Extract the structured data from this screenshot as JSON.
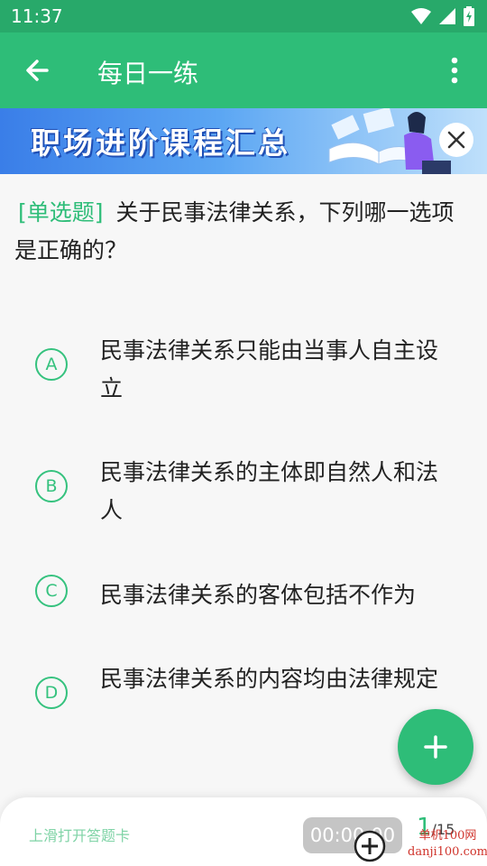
{
  "status_bar": {
    "time": "11:37"
  },
  "app_bar": {
    "title": "每日一练"
  },
  "banner": {
    "text": "职场进阶课程汇总"
  },
  "question": {
    "type_label": "[单选题]",
    "text": "关于民事法律关系，下列哪一选项是正确的？"
  },
  "options": [
    {
      "letter": "A",
      "text": "民事法律关系只能由当事人自主设立"
    },
    {
      "letter": "B",
      "text": "民事法律关系的主体即自然人和法人"
    },
    {
      "letter": "C",
      "text": "民事法律关系的客体包括不作为"
    },
    {
      "letter": "D",
      "text": "民事法律关系的内容均由法律规定"
    }
  ],
  "bottom_bar": {
    "swipe_hint": "上滑打开答题卡",
    "timer": "00:00:00",
    "current": "1",
    "total": "/15"
  },
  "watermark": {
    "line1": "单机100网",
    "line2": "danji100.com"
  },
  "colors": {
    "primary": "#2ebd78",
    "status_bar": "#28a96a",
    "option_accent": "#35c27e"
  }
}
